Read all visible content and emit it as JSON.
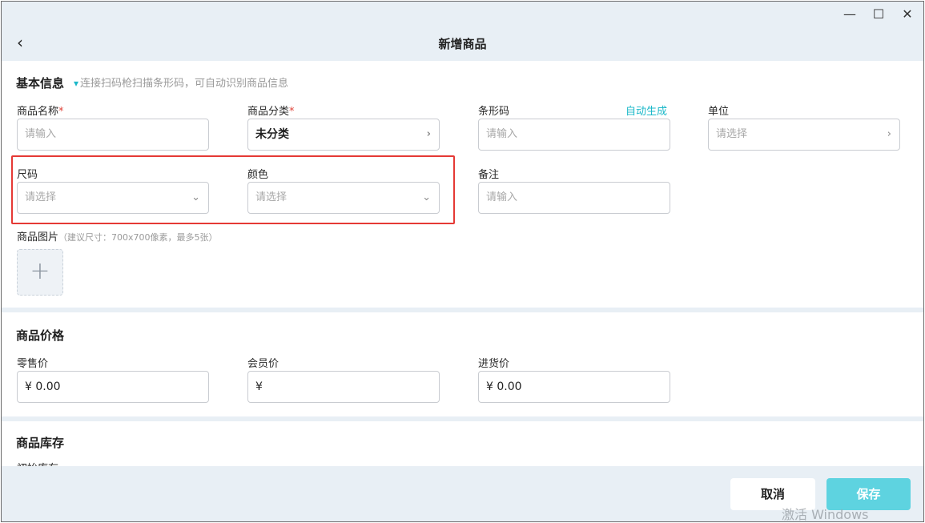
{
  "window": {
    "controls": {
      "minimize": "—",
      "maximize": "☐",
      "close": "✕"
    }
  },
  "header": {
    "back_icon": "‹",
    "title": "新增商品"
  },
  "basic": {
    "title": "基本信息",
    "scan_icon": "barcode-scanner-icon",
    "scan_tip": "连接扫码枪扫描条形码，可自动识别商品信息",
    "name": {
      "label": "商品名称",
      "required": "*",
      "placeholder": "请输入"
    },
    "category": {
      "label": "商品分类",
      "required": "*",
      "value": "未分类"
    },
    "barcode": {
      "label": "条形码",
      "auto_generate": "自动生成",
      "placeholder": "请输入"
    },
    "unit": {
      "label": "单位",
      "placeholder": "请选择"
    },
    "size": {
      "label": "尺码",
      "placeholder": "请选择"
    },
    "color": {
      "label": "颜色",
      "placeholder": "请选择"
    },
    "remark": {
      "label": "备注",
      "placeholder": "请输入"
    },
    "images": {
      "label": "商品图片",
      "hint": "（建议尺寸：700x700像素，最多5张）",
      "add_icon": "+"
    }
  },
  "price": {
    "title": "商品价格",
    "retail": {
      "label": "零售价",
      "value": "¥  0.00"
    },
    "member": {
      "label": "会员价",
      "value": "¥"
    },
    "purchase": {
      "label": "进货价",
      "value": "¥  0.00"
    }
  },
  "stock": {
    "title": "商品库存",
    "initial_label": "初始库存"
  },
  "footer": {
    "cancel": "取消",
    "save": "保存"
  },
  "watermark": "激活 Windows",
  "colors": {
    "accent": "#1bb8c9",
    "save_button": "#5ed3e0",
    "highlight": "#e53935",
    "required": "#e0453a"
  }
}
